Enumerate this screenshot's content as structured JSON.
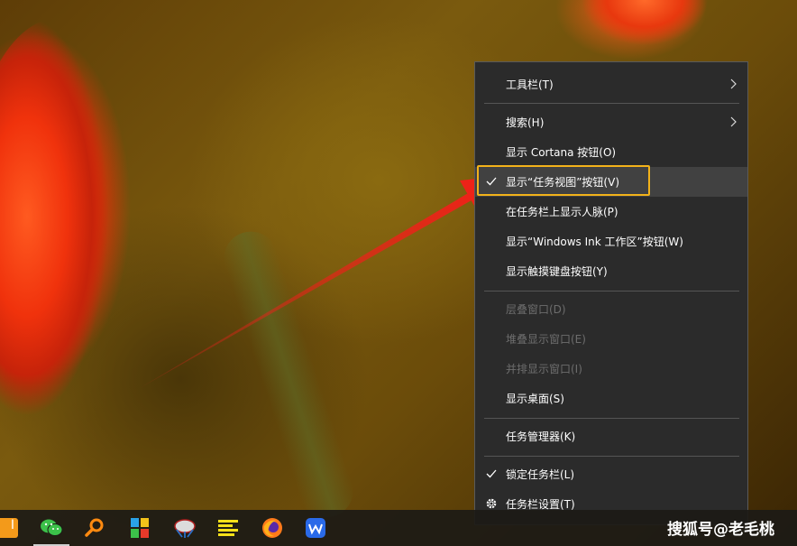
{
  "menu": {
    "items": [
      {
        "label": "工具栏(T)",
        "submenu": true,
        "enabled": true
      },
      {
        "label": "搜索(H)",
        "submenu": true,
        "enabled": true
      },
      {
        "label": "显示 Cortana 按钮(O)",
        "enabled": true
      },
      {
        "label": "显示“任务视图”按钮(V)",
        "checked": true,
        "enabled": true
      },
      {
        "label": "在任务栏上显示人脉(P)",
        "enabled": true
      },
      {
        "label": "显示“Windows Ink 工作区”按钮(W)",
        "enabled": true
      },
      {
        "label": "显示触摸键盘按钮(Y)",
        "enabled": true
      },
      {
        "label": "层叠窗口(D)",
        "enabled": false
      },
      {
        "label": "堆叠显示窗口(E)",
        "enabled": false
      },
      {
        "label": "并排显示窗口(I)",
        "enabled": false
      },
      {
        "label": "显示桌面(S)",
        "enabled": true
      },
      {
        "label": "任务管理器(K)",
        "enabled": true
      },
      {
        "label": "锁定任务栏(L)",
        "checked": true,
        "enabled": true
      },
      {
        "label": "任务栏设置(T)",
        "icon": "gear-icon",
        "enabled": true
      }
    ]
  },
  "taskbar": {
    "edge_label": "I",
    "icons": [
      "app-tile-icon",
      "wechat-icon",
      "search-magnifier-icon",
      "colorful-blocks-icon",
      "network-globe-icon",
      "notes-lines-icon",
      "firefox-icon",
      "wps-office-icon"
    ]
  },
  "watermark": "搜狐号@老毛桃",
  "colors": {
    "menu_bg": "#2b2b2b",
    "menu_hover": "#414141",
    "highlight_box": "#f2b21a",
    "arrow": "#e8201a",
    "disabled_text": "#6d6d6d"
  }
}
